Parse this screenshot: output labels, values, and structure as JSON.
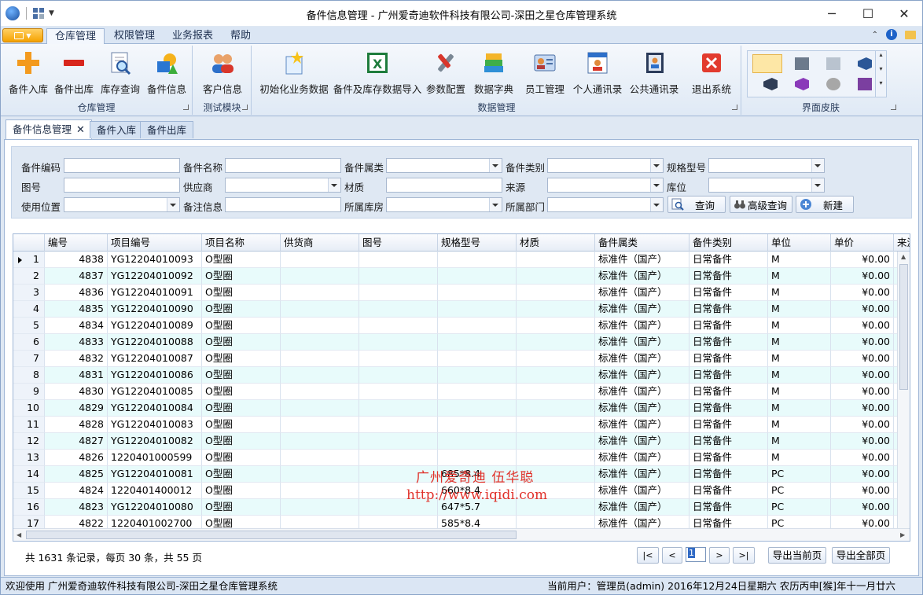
{
  "window": {
    "title": "备件信息管理 - 广州爱奇迪软件科技有限公司-深田之星仓库管理系统",
    "minimize": "─",
    "maximize": "☐",
    "close": "✕"
  },
  "ribbon_tabs": [
    "仓库管理",
    "权限管理",
    "业务报表",
    "帮助"
  ],
  "ribbon": {
    "groups": [
      {
        "label": "仓库管理",
        "buttons": [
          "备件入库",
          "备件出库",
          "库存查询",
          "备件信息"
        ]
      },
      {
        "label": "测试模块",
        "buttons": [
          "客户信息"
        ]
      },
      {
        "label": "数据管理",
        "buttons": [
          "初始化业务数据",
          "备件及库存数据导入",
          "参数配置",
          "数据字典",
          "员工管理",
          "个人通讯录",
          "公共通讯录",
          "退出系统"
        ]
      },
      {
        "label": "界面皮肤",
        "buttons": []
      }
    ]
  },
  "doc_tabs": [
    "备件信息管理",
    "备件入库",
    "备件出库"
  ],
  "search": {
    "labels": {
      "code": "备件编码",
      "name": "备件名称",
      "belong": "备件属类",
      "category": "备件类别",
      "spec": "规格型号",
      "drawing": "图号",
      "supplier": "供应商",
      "material": "材质",
      "source": "来源",
      "location": "库位",
      "use_position": "使用位置",
      "remark": "备注信息",
      "warehouse": "所属库房",
      "dept": "所属部门"
    },
    "buttons": {
      "query": "查询",
      "advanced": "高级查询",
      "new": "新建"
    }
  },
  "table": {
    "columns": [
      "编号",
      "项目编号",
      "项目名称",
      "供货商",
      "图号",
      "规格型号",
      "材质",
      "备件属类",
      "备件类别",
      "单位",
      "单价",
      "来源"
    ],
    "rows": [
      {
        "n": "1",
        "id": "4838",
        "code": "YG12204010093",
        "name": "O型圈",
        "spec": "",
        "belong": "标准件（国产）",
        "cat": "日常备件",
        "unit": "M",
        "price": "¥0.00"
      },
      {
        "n": "2",
        "id": "4837",
        "code": "YG12204010092",
        "name": "O型圈",
        "spec": "",
        "belong": "标准件（国产）",
        "cat": "日常备件",
        "unit": "M",
        "price": "¥0.00"
      },
      {
        "n": "3",
        "id": "4836",
        "code": "YG12204010091",
        "name": "O型圈",
        "spec": "",
        "belong": "标准件（国产）",
        "cat": "日常备件",
        "unit": "M",
        "price": "¥0.00"
      },
      {
        "n": "4",
        "id": "4835",
        "code": "YG12204010090",
        "name": "O型圈",
        "spec": "",
        "belong": "标准件（国产）",
        "cat": "日常备件",
        "unit": "M",
        "price": "¥0.00"
      },
      {
        "n": "5",
        "id": "4834",
        "code": "YG12204010089",
        "name": "O型圈",
        "spec": "",
        "belong": "标准件（国产）",
        "cat": "日常备件",
        "unit": "M",
        "price": "¥0.00"
      },
      {
        "n": "6",
        "id": "4833",
        "code": "YG12204010088",
        "name": "O型圈",
        "spec": "",
        "belong": "标准件（国产）",
        "cat": "日常备件",
        "unit": "M",
        "price": "¥0.00"
      },
      {
        "n": "7",
        "id": "4832",
        "code": "YG12204010087",
        "name": "O型圈",
        "spec": "",
        "belong": "标准件（国产）",
        "cat": "日常备件",
        "unit": "M",
        "price": "¥0.00"
      },
      {
        "n": "8",
        "id": "4831",
        "code": "YG12204010086",
        "name": "O型圈",
        "spec": "",
        "belong": "标准件（国产）",
        "cat": "日常备件",
        "unit": "M",
        "price": "¥0.00"
      },
      {
        "n": "9",
        "id": "4830",
        "code": "YG12204010085",
        "name": "O型圈",
        "spec": "",
        "belong": "标准件（国产）",
        "cat": "日常备件",
        "unit": "M",
        "price": "¥0.00"
      },
      {
        "n": "10",
        "id": "4829",
        "code": "YG12204010084",
        "name": "O型圈",
        "spec": "",
        "belong": "标准件（国产）",
        "cat": "日常备件",
        "unit": "M",
        "price": "¥0.00"
      },
      {
        "n": "11",
        "id": "4828",
        "code": "YG12204010083",
        "name": "O型圈",
        "spec": "",
        "belong": "标准件（国产）",
        "cat": "日常备件",
        "unit": "M",
        "price": "¥0.00"
      },
      {
        "n": "12",
        "id": "4827",
        "code": "YG12204010082",
        "name": "O型圈",
        "spec": "",
        "belong": "标准件（国产）",
        "cat": "日常备件",
        "unit": "M",
        "price": "¥0.00"
      },
      {
        "n": "13",
        "id": "4826",
        "code": "1220401000599",
        "name": "O型圈",
        "spec": "",
        "belong": "标准件（国产）",
        "cat": "日常备件",
        "unit": "M",
        "price": "¥0.00"
      },
      {
        "n": "14",
        "id": "4825",
        "code": "YG12204010081",
        "name": "O型圈",
        "spec": "685*8.4",
        "belong": "标准件（国产）",
        "cat": "日常备件",
        "unit": "PC",
        "price": "¥0.00"
      },
      {
        "n": "15",
        "id": "4824",
        "code": "1220401400012",
        "name": "O型圈",
        "spec": "660*8.4",
        "belong": "标准件（国产）",
        "cat": "日常备件",
        "unit": "PC",
        "price": "¥0.00"
      },
      {
        "n": "16",
        "id": "4823",
        "code": "YG12204010080",
        "name": "O型圈",
        "spec": "647*5.7",
        "belong": "标准件（国产）",
        "cat": "日常备件",
        "unit": "PC",
        "price": "¥0.00"
      },
      {
        "n": "17",
        "id": "4822",
        "code": "1220401002700",
        "name": "O型圈",
        "spec": "585*8.4",
        "belong": "标准件（国产）",
        "cat": "日常备件",
        "unit": "PC",
        "price": "¥0.00"
      }
    ]
  },
  "watermark": {
    "line1": "广州爱奇迪 伍华聪",
    "line2": "http://www.iqidi.com"
  },
  "pager": {
    "info": "共 1631 条记录，每页 30 条，共 55 页",
    "first": "|<",
    "prev": "<",
    "current": "1",
    "next": ">",
    "last": ">|",
    "export_page": "导出当前页",
    "export_all": "导出全部页"
  },
  "status": {
    "welcome": "欢迎使用 广州爱奇迪软件科技有限公司-深田之星仓库管理系统",
    "user": "当前用户：管理员(admin)   2016年12月24日星期六 农历丙申[猴]年十一月廿六"
  },
  "colors": {
    "accent": "#316ac5",
    "row_alt": "#e8fbfb",
    "ribbon": "#dfe9f5",
    "watermark": "#e0312a"
  }
}
